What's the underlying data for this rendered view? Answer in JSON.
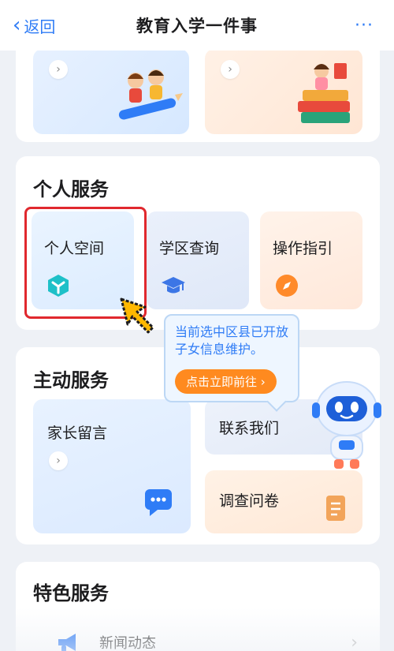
{
  "header": {
    "back_label": "返回",
    "title": "教育入学一件事",
    "more": "···"
  },
  "top_banners": [
    {
      "arrow": "›",
      "illustration": "kids-on-pencil"
    },
    {
      "arrow": "›",
      "illustration": "reading-books"
    }
  ],
  "personal": {
    "title": "个人服务",
    "tiles": [
      {
        "label": "个人空间",
        "icon": "cube-icon"
      },
      {
        "label": "学区查询",
        "icon": "graduation-cap-icon"
      },
      {
        "label": "操作指引",
        "icon": "compass-icon"
      }
    ]
  },
  "tooltip": {
    "message": "当前选中区县已开放子女信息维护。",
    "button": "点击立即前往 ›"
  },
  "active": {
    "title": "主动服务",
    "tiles": [
      {
        "label": "家长留言",
        "arrow": "›",
        "icon": "message-icon"
      },
      {
        "label": "联系我们"
      },
      {
        "label": "调查问卷",
        "icon": "document-icon"
      }
    ]
  },
  "featured": {
    "title": "特色服务",
    "items": [
      {
        "label": "新闻动态",
        "icon": "megaphone-icon",
        "arrow": "›"
      }
    ]
  },
  "colors": {
    "accent": "#2f7cf6",
    "highlight": "#e0282e",
    "cta": "#ff8a1f"
  }
}
